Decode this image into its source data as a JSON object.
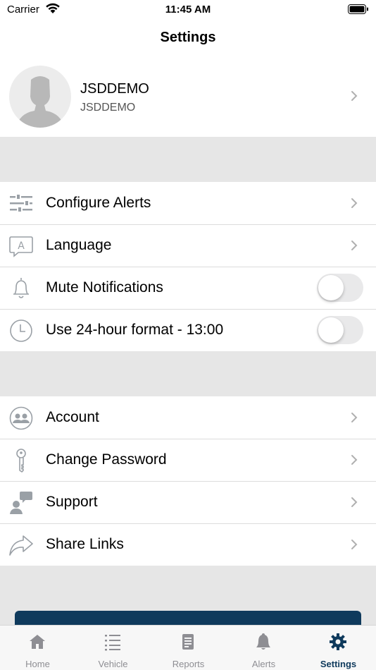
{
  "status_bar": {
    "carrier": "Carrier",
    "time": "11:45 AM"
  },
  "nav": {
    "title": "Settings"
  },
  "profile": {
    "name": "JSDDEMO",
    "subtitle": "JSDDEMO"
  },
  "group1": [
    {
      "label": "Configure Alerts",
      "icon": "sliders-icon",
      "control": "chevron"
    },
    {
      "label": "Language",
      "icon": "language-icon",
      "control": "chevron"
    },
    {
      "label": "Mute Notifications",
      "icon": "bell-icon",
      "control": "toggle",
      "on": false
    },
    {
      "label": "Use 24-hour format - 13:00",
      "icon": "clock-icon",
      "control": "toggle",
      "on": false
    }
  ],
  "group2": [
    {
      "label": "Account",
      "icon": "people-icon",
      "control": "chevron"
    },
    {
      "label": "Change Password",
      "icon": "key-icon",
      "control": "chevron"
    },
    {
      "label": "Support",
      "icon": "support-icon",
      "control": "chevron"
    },
    {
      "label": "Share Links",
      "icon": "share-icon",
      "control": "chevron"
    }
  ],
  "tabs": [
    {
      "label": "Home",
      "icon": "home-icon"
    },
    {
      "label": "Vehicle",
      "icon": "list-icon"
    },
    {
      "label": "Reports",
      "icon": "reports-icon"
    },
    {
      "label": "Alerts",
      "icon": "bell-icon"
    },
    {
      "label": "Settings",
      "icon": "gear-icon",
      "active": true
    }
  ],
  "colors": {
    "accent": "#0f3a5c",
    "inactive": "#8e8e93",
    "background": "#e6e6e6"
  }
}
